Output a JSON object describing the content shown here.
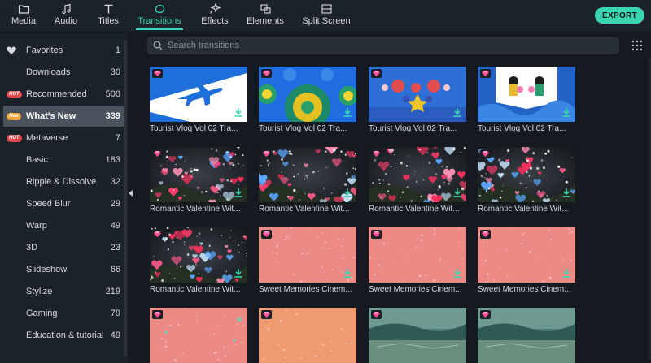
{
  "toolbar": {
    "tabs": [
      {
        "label": "Media",
        "icon": "folder-icon"
      },
      {
        "label": "Audio",
        "icon": "music-note-icon"
      },
      {
        "label": "Titles",
        "icon": "text-t-icon"
      },
      {
        "label": "Transitions",
        "icon": "transition-swirl-icon",
        "active": true
      },
      {
        "label": "Effects",
        "icon": "sparkle-icon"
      },
      {
        "label": "Elements",
        "icon": "elements-icon"
      },
      {
        "label": "Split Screen",
        "icon": "split-screen-icon"
      }
    ],
    "export_label": "EXPORT",
    "accent_color": "#33d6b5"
  },
  "sidebar": {
    "items": [
      {
        "label": "Favorites",
        "count": "1",
        "icon": "heart-icon"
      },
      {
        "label": "Downloads",
        "count": "30"
      },
      {
        "label": "Recommended",
        "count": "500",
        "badge": "HOT"
      },
      {
        "label": "What's New",
        "count": "339",
        "badge": "New",
        "active": true
      },
      {
        "label": "Metaverse",
        "count": "7",
        "badge": "HOT"
      },
      {
        "label": "Basic",
        "count": "183"
      },
      {
        "label": "Ripple & Dissolve",
        "count": "32"
      },
      {
        "label": "Speed Blur",
        "count": "29"
      },
      {
        "label": "Warp",
        "count": "49"
      },
      {
        "label": "3D",
        "count": "23"
      },
      {
        "label": "Slideshow",
        "count": "66"
      },
      {
        "label": "Stylize",
        "count": "219"
      },
      {
        "label": "Gaming",
        "count": "79"
      },
      {
        "label": "Education & tutorial",
        "count": "49"
      }
    ]
  },
  "search": {
    "placeholder": "Search transitions"
  },
  "grid": {
    "items": [
      {
        "label": "Tourist Vlog Vol 02 Tra...",
        "style": "tourist-plane"
      },
      {
        "label": "Tourist Vlog Vol 02 Tra...",
        "style": "tourist-circles"
      },
      {
        "label": "Tourist Vlog Vol 02 Tra...",
        "style": "tourist-flowers"
      },
      {
        "label": "Tourist Vlog Vol 02 Tra...",
        "style": "tourist-people"
      },
      {
        "label": "Romantic Valentine Wit...",
        "style": "valentine"
      },
      {
        "label": "Romantic Valentine Wit...",
        "style": "valentine"
      },
      {
        "label": "Romantic Valentine Wit...",
        "style": "valentine"
      },
      {
        "label": "Romantic Valentine Wit...",
        "style": "valentine"
      },
      {
        "label": "Romantic Valentine Wit...",
        "style": "valentine"
      },
      {
        "label": "Sweet Memories Cinem...",
        "style": "sweet-pink"
      },
      {
        "label": "Sweet Memories Cinem...",
        "style": "sweet-pink"
      },
      {
        "label": "Sweet Memories Cinem...",
        "style": "sweet-pink"
      },
      {
        "label": "",
        "style": "sweet-pink"
      },
      {
        "label": "",
        "style": "sweet-orange"
      },
      {
        "label": "",
        "style": "landscape"
      },
      {
        "label": "",
        "style": "landscape"
      }
    ]
  }
}
